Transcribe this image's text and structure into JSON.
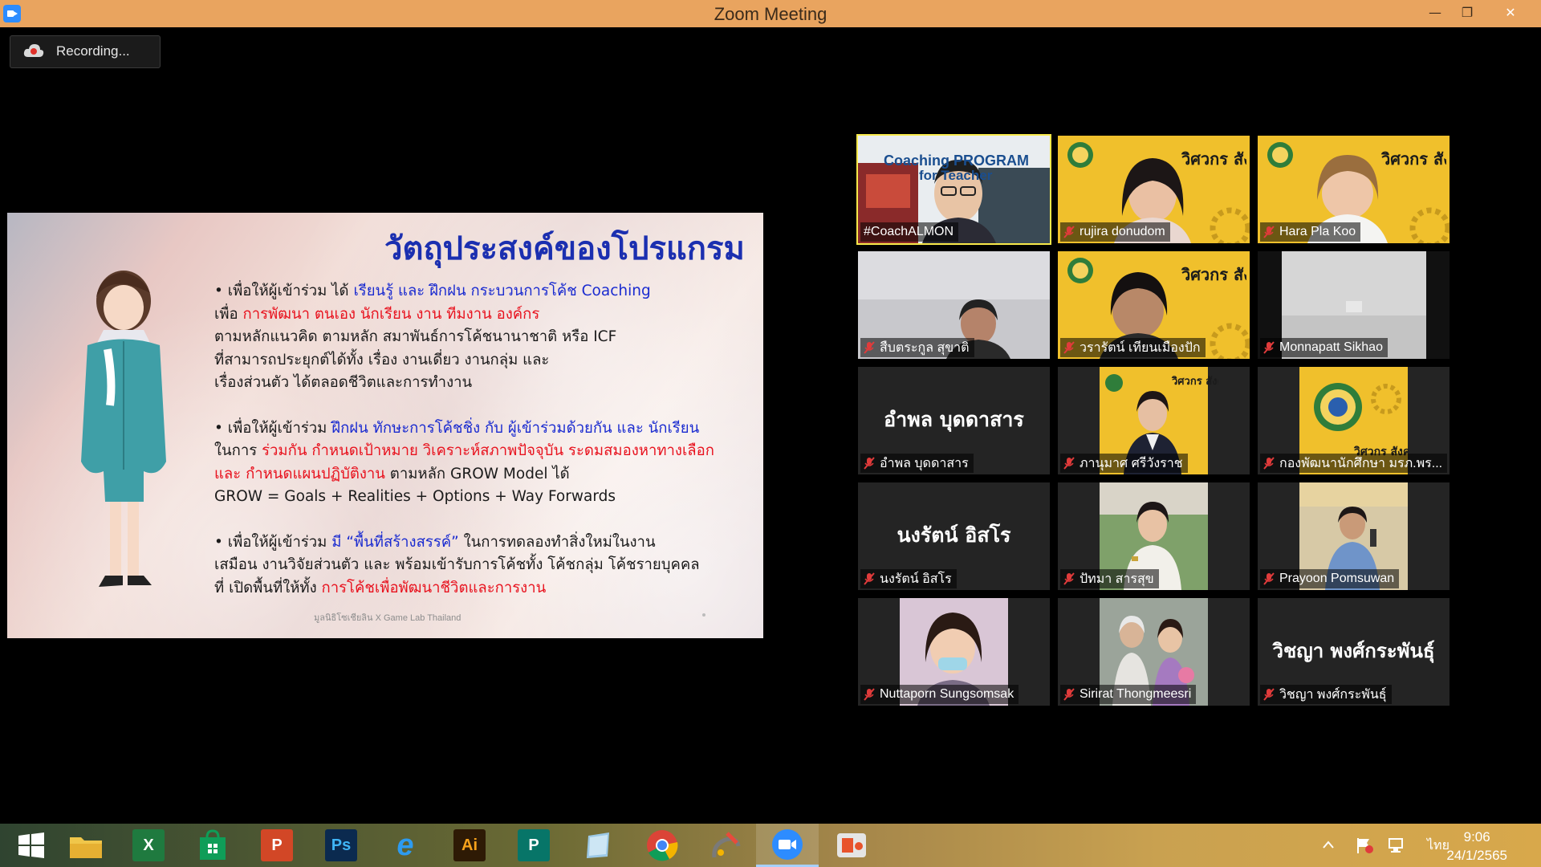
{
  "window": {
    "title": "Zoom Meeting",
    "minimize": "—",
    "restore": "❐",
    "close": "✕"
  },
  "recording": {
    "label": "Recording...",
    "icon": "cloud-record-icon"
  },
  "slide": {
    "heading": "วัตถุประสงค์ของโปรแกรม",
    "p1": {
      "l1a": "• เพื่อให้ผู้เข้าร่วม ได้ ",
      "l1b": "เรียนรู้ และ ฝึกฝน กระบวนการโค้ช Coaching",
      "l2a": "เพื่อ ",
      "l2b": "การพัฒนา ตนเอง นักเรียน งาน ทีมงาน องค์กร",
      "l3": "ตามหลักแนวคิด ตามหลัก สมาพันธ์การโค้ชนานาชาติ หรือ ICF",
      "l4": "ที่สามารถประยุกต์ได้ทั้ง เรื่อง งานเดี่ยว งานกลุ่ม และ",
      "l5": "เรื่องส่วนตัว ได้ตลอดชีวิตและการทำงาน"
    },
    "p2": {
      "l1a": "• เพื่อให้ผู้เข้าร่วม ",
      "l1b": "ฝึกฝน ทักษะการโค้ชชิ่ง กับ ผู้เข้าร่วมด้วยกัน และ นักเรียน",
      "l2a": "ในการ ",
      "l2b": "ร่วมกัน กำหนดเป้าหมาย วิเคราะห์สภาพปัจจุบัน ระดมสมองหาทางเลือก",
      "l3a": "และ กำหนดแผนปฏิบัติงาน",
      "l3b": " ตามหลัก GROW Model ได้",
      "l4": "GROW = Goals + Realities + Options + Way Forwards"
    },
    "p3": {
      "l1a": "• เพื่อให้ผู้เข้าร่วม ",
      "l1b": "มี “พื้นที่สร้างสรรค์”",
      "l1c": " ในการทดลองทำสิ่งใหม่ในงาน",
      "l2": "เสมือน งานวิจัยส่วนตัว และ พร้อมเข้ารับการโค้ชทั้ง โค้ชกลุ่ม โค้ชรายบุคคล",
      "l3a": "ที่ เปิดพื้นที่ให้ทั้ง ",
      "l3b": "การโค้ชเพื่อพัฒนาชีวิตและการงาน"
    },
    "footer": "มูลนิธิโซเชียลิน X Game Lab Thailand",
    "colors": {
      "heading": "#1b2fb0",
      "blue": "#1a2bd0",
      "red": "#e8121e"
    }
  },
  "participants": [
    {
      "name": "#CoachALMON",
      "muted": false,
      "active": true,
      "video": "coaching-program-banner",
      "banner": "Coaching PROGRAM",
      "banner2": "for Teacher"
    },
    {
      "name": "rujira donudom",
      "muted": true,
      "video": "person-yellow-bg"
    },
    {
      "name": "Hara Pla Koo",
      "muted": true,
      "video": "person-yellow-bg"
    },
    {
      "name": "สืบตระกูล สุขาติ",
      "muted": true,
      "video": "person-gray-room"
    },
    {
      "name": "วรารัตน์ เทียนเมืองปัก",
      "muted": true,
      "video": "person-yellow-bg"
    },
    {
      "name": "Monnapatt Sikhao",
      "muted": true,
      "video": "empty-room"
    },
    {
      "name": "อำพล บุดดาสาร",
      "muted": true,
      "display": "อำพล บุดดาสาร"
    },
    {
      "name": "ภานุมาศ ศรีวังราช",
      "muted": true,
      "video": "portrait-photo"
    },
    {
      "name": "กองพัฒนานักศึกษา มรภ.พร...",
      "muted": true,
      "video": "university-logo"
    },
    {
      "name": "นงรัตน์ อิสโร",
      "muted": true,
      "display": "นงรัตน์ อิสโร"
    },
    {
      "name": "ปัทมา สารสุข",
      "muted": true,
      "video": "portrait-photo"
    },
    {
      "name": "Prayoon Pomsuwan",
      "muted": true,
      "video": "speaker-photo"
    },
    {
      "name": "Nuttaporn Sungsomsak",
      "muted": true,
      "video": "portrait-photo"
    },
    {
      "name": "Sirirat Thongmeesri",
      "muted": true,
      "video": "family-photo"
    },
    {
      "name": "วิชญา พงศ์กระพันธุ์",
      "muted": true,
      "display": "วิชญา พงศ์กระพันธุ์"
    }
  ],
  "logo_text": "วิศวกร สังคม",
  "taskbar": {
    "apps": [
      {
        "name": "start-icon"
      },
      {
        "name": "file-explorer-icon"
      },
      {
        "name": "excel-icon",
        "label": "X"
      },
      {
        "name": "store-icon"
      },
      {
        "name": "powerpoint-icon",
        "label": "P"
      },
      {
        "name": "photoshop-icon",
        "label": "Ps"
      },
      {
        "name": "internet-explorer-icon",
        "label": "e"
      },
      {
        "name": "illustrator-icon",
        "label": "Ai"
      },
      {
        "name": "publisher-icon",
        "label": "P"
      },
      {
        "name": "tablet-app-icon"
      },
      {
        "name": "chrome-icon"
      },
      {
        "name": "paint-icon"
      },
      {
        "name": "zoom-icon"
      },
      {
        "name": "camera-app-icon"
      }
    ],
    "lang": "ไทย",
    "time": "9:06",
    "date": "24/1/2565"
  }
}
